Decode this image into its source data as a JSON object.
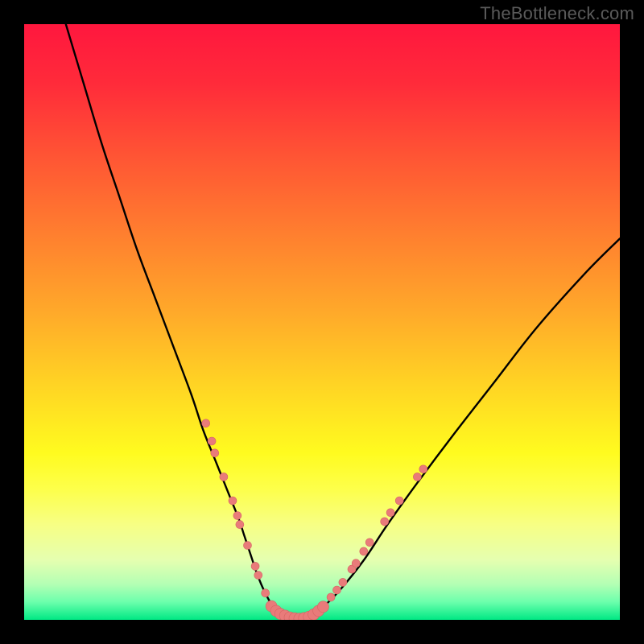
{
  "watermark": "TheBottleneck.com",
  "gradient": {
    "stops": [
      {
        "offset": 0.0,
        "color": "#ff173e"
      },
      {
        "offset": 0.1,
        "color": "#ff2b3a"
      },
      {
        "offset": 0.22,
        "color": "#ff5434"
      },
      {
        "offset": 0.35,
        "color": "#ff7e2f"
      },
      {
        "offset": 0.48,
        "color": "#ffa82a"
      },
      {
        "offset": 0.6,
        "color": "#ffd224"
      },
      {
        "offset": 0.72,
        "color": "#fffb1f"
      },
      {
        "offset": 0.78,
        "color": "#fdff4a"
      },
      {
        "offset": 0.84,
        "color": "#f7ff84"
      },
      {
        "offset": 0.9,
        "color": "#e5ffb0"
      },
      {
        "offset": 0.94,
        "color": "#b4ffb4"
      },
      {
        "offset": 0.97,
        "color": "#6cffac"
      },
      {
        "offset": 1.0,
        "color": "#00e884"
      }
    ]
  },
  "curve": {
    "stroke": "#000000",
    "width": 2.4
  },
  "markers": {
    "fill": "#e97b7a",
    "stroke": "#d46463",
    "radius_small": 5,
    "radius_large": 7
  },
  "chart_data": {
    "type": "line",
    "title": "",
    "xlabel": "",
    "ylabel": "",
    "xlim": [
      0,
      100
    ],
    "ylim": [
      0,
      100
    ],
    "grid": false,
    "legend": false,
    "series": [
      {
        "name": "curve",
        "x": [
          7,
          10,
          13,
          16,
          19,
          22,
          25,
          28,
          30,
          32,
          34,
          36,
          37,
          38,
          39,
          40,
          41,
          42,
          44,
          46,
          48,
          50,
          53,
          57,
          61,
          66,
          72,
          79,
          86,
          94,
          100
        ],
        "y": [
          100,
          90,
          80,
          71,
          62,
          54,
          46,
          38,
          32,
          27,
          22,
          17,
          14,
          11,
          8,
          5.5,
          3.5,
          2,
          0.8,
          0.2,
          0.6,
          2,
          5,
          10,
          16,
          23,
          31,
          40,
          49,
          58,
          64
        ]
      }
    ],
    "markers_left": [
      {
        "x": 30.5,
        "y": 33
      },
      {
        "x": 31.5,
        "y": 30
      },
      {
        "x": 32.0,
        "y": 28
      },
      {
        "x": 33.5,
        "y": 24
      },
      {
        "x": 35.0,
        "y": 20
      },
      {
        "x": 35.8,
        "y": 17.5
      },
      {
        "x": 36.2,
        "y": 16
      },
      {
        "x": 37.5,
        "y": 12.5
      },
      {
        "x": 38.8,
        "y": 9
      },
      {
        "x": 39.3,
        "y": 7.5
      },
      {
        "x": 40.5,
        "y": 4.5
      }
    ],
    "markers_bottom": [
      {
        "x": 41.5,
        "y": 2.3
      },
      {
        "x": 42.3,
        "y": 1.5
      },
      {
        "x": 43.0,
        "y": 1.0
      },
      {
        "x": 43.8,
        "y": 0.7
      },
      {
        "x": 44.6,
        "y": 0.4
      },
      {
        "x": 45.4,
        "y": 0.25
      },
      {
        "x": 46.2,
        "y": 0.2
      },
      {
        "x": 47.0,
        "y": 0.3
      },
      {
        "x": 47.8,
        "y": 0.5
      },
      {
        "x": 48.6,
        "y": 0.9
      },
      {
        "x": 49.4,
        "y": 1.5
      },
      {
        "x": 50.2,
        "y": 2.2
      }
    ],
    "markers_right": [
      {
        "x": 51.5,
        "y": 3.8
      },
      {
        "x": 52.5,
        "y": 5.0
      },
      {
        "x": 53.5,
        "y": 6.3
      },
      {
        "x": 55.0,
        "y": 8.5
      },
      {
        "x": 55.7,
        "y": 9.5
      },
      {
        "x": 57.0,
        "y": 11.5
      },
      {
        "x": 58.0,
        "y": 13
      },
      {
        "x": 60.5,
        "y": 16.5
      },
      {
        "x": 61.5,
        "y": 18
      },
      {
        "x": 63.0,
        "y": 20
      },
      {
        "x": 66.0,
        "y": 24
      },
      {
        "x": 67.0,
        "y": 25.3
      }
    ]
  }
}
